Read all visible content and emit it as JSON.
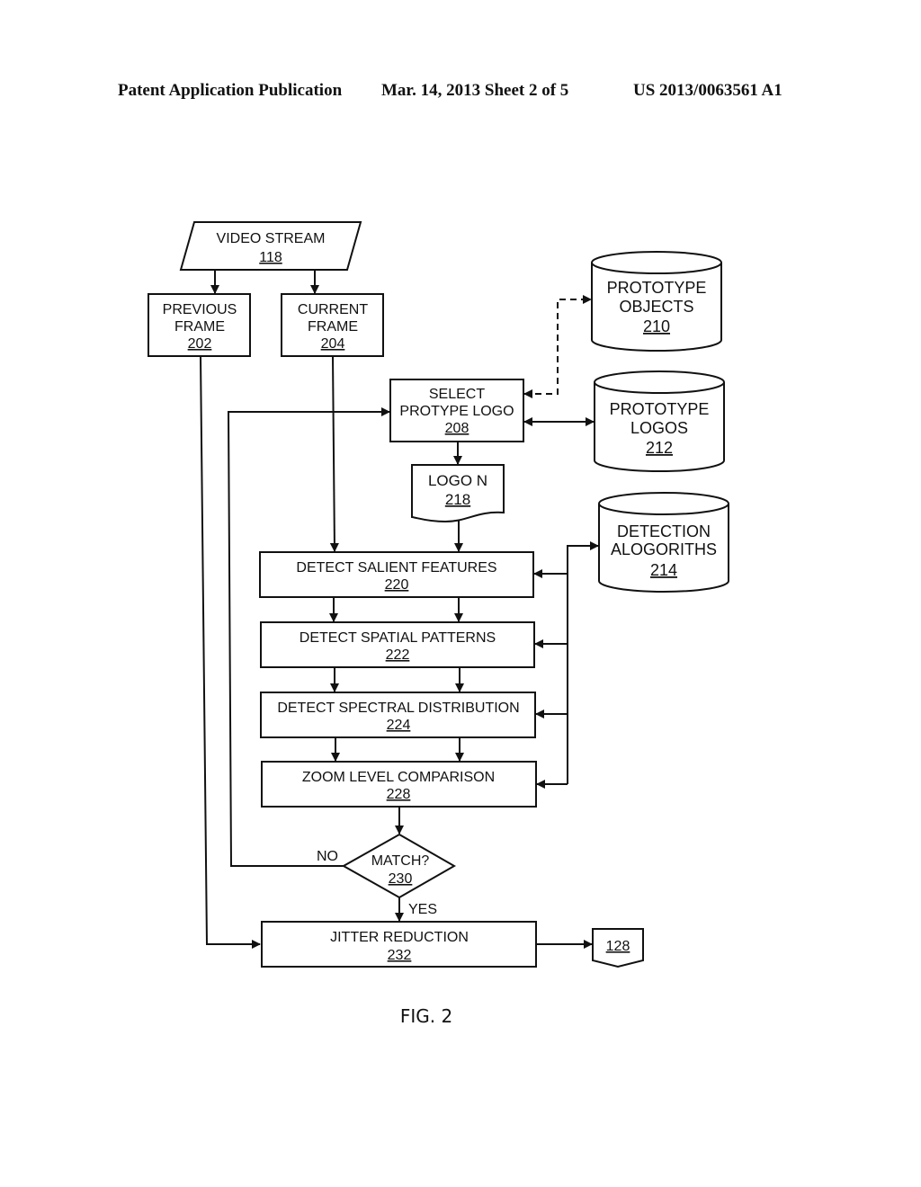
{
  "header": {
    "publication": "Patent Application Publication",
    "date_sheet": "Mar. 14, 2013  Sheet 2 of 5",
    "number": "US 2013/0063561 A1"
  },
  "figure_label": "FIG. 2",
  "nodes": {
    "video_stream": {
      "line1": "VIDEO STREAM",
      "ref": "118"
    },
    "previous_frame": {
      "line1": "PREVIOUS",
      "line2": "FRAME",
      "ref": "202"
    },
    "current_frame": {
      "line1": "CURRENT",
      "line2": "FRAME",
      "ref": "204"
    },
    "select_logo": {
      "line1": "SELECT",
      "line2": "PROTYPE LOGO",
      "ref": "208"
    },
    "prototype_objects": {
      "line1": "PROTOTYPE",
      "line2": "OBJECTS",
      "ref": "210"
    },
    "prototype_logos": {
      "line1": "PROTOTYPE",
      "line2": "LOGOS",
      "ref": "212"
    },
    "logo_n": {
      "line1": "LOGO N",
      "ref": "218"
    },
    "detection_algorithms": {
      "line1": "DETECTION",
      "line2": "ALOGORITHS",
      "ref": "214"
    },
    "salient": {
      "line1": "DETECT SALIENT FEATURES",
      "ref": "220"
    },
    "spatial": {
      "line1": "DETECT SPATIAL PATTERNS",
      "ref": "222"
    },
    "spectral": {
      "line1": "DETECT SPECTRAL DISTRIBUTION",
      "ref": "224"
    },
    "zoom": {
      "line1": "ZOOM LEVEL COMPARISON",
      "ref": "228"
    },
    "match": {
      "line1": "MATCH?",
      "ref": "230",
      "no_label": "NO",
      "yes_label": "YES"
    },
    "jitter": {
      "line1": "JITTER REDUCTION",
      "ref": "232"
    },
    "offpage": {
      "ref": "128"
    }
  }
}
